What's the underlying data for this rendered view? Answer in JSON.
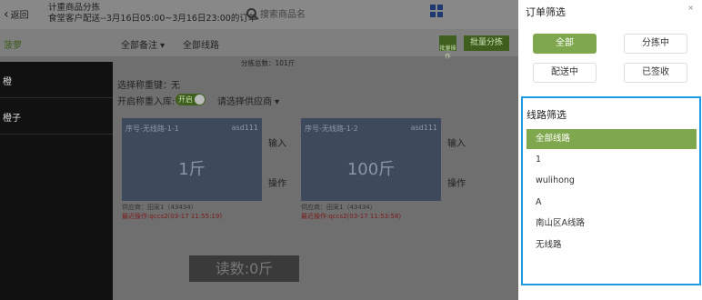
{
  "header": {
    "back_label": "返回",
    "title_line1": "计重商品分拣",
    "title_line2": "食堂客户配送--3月16日05:00~3月16日23:00的订单",
    "search_placeholder": "搜索商品名"
  },
  "toolbar": {
    "left_label": "菠萝",
    "remark_dropdown": "全部备注",
    "route_dropdown": "全部线路",
    "btn_small": "批量操作",
    "btn_batch": "批量分拣"
  },
  "left_panel": {
    "items": [
      "橙",
      "橙子"
    ]
  },
  "summary": {
    "total_text": "分拣总数：101斤"
  },
  "options": {
    "reweigh_label": "选择称重键：",
    "reweigh_value": "无",
    "reweigh_inbound_label": "开启称重入库:",
    "toggle_label": "开启",
    "supplier_placeholder": "请选择供应商"
  },
  "cards": [
    {
      "seq": "序号-无线路-1-1",
      "code": "asd111",
      "value": "1斤",
      "input_label": "输入",
      "action_label": "操作",
      "supplier": "供应商：田采1（43434）",
      "last_op": "最近操作:qccs2(03-17 11:55:19)"
    },
    {
      "seq": "序号-无线路-1-2",
      "code": "asd111",
      "value": "100斤",
      "input_label": "输入",
      "action_label": "操作",
      "supplier": "供应商：田采1（43434）",
      "last_op": "最近操作:qccs2(03-17 11:53:58)"
    }
  ],
  "reading": "读数:0斤",
  "drawer": {
    "title": "订单筛选",
    "close_icon": "×",
    "status_buttons": [
      "全部",
      "分拣中",
      "配送中",
      "已签收"
    ],
    "active_status": "全部",
    "route_title": "线路筛选",
    "routes": [
      "全部线路",
      "1",
      "wulihong",
      "A",
      "南山区A线路",
      "无线路"
    ],
    "active_route": "全部线路"
  },
  "colors": {
    "accent_green": "#7fa84e",
    "route_border": "#1e9be0"
  }
}
